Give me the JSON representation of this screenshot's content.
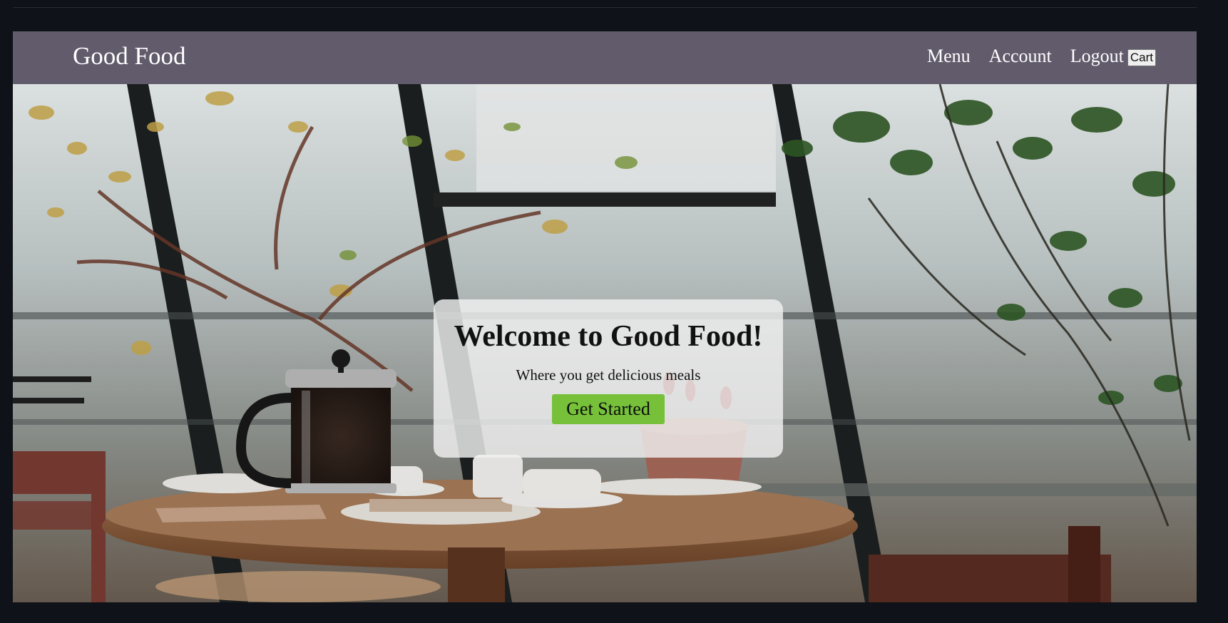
{
  "navbar": {
    "brand": "Good Food",
    "links": [
      "Menu",
      "Account",
      "Logout"
    ],
    "cart_label": "Cart",
    "background_color": "#625b6c"
  },
  "hero": {
    "background_image": "cafe-table-with-french-press-and-plants",
    "title": "Welcome to Good Food!",
    "subtitle": "Where you get delicious meals",
    "cta_label": "Get Started",
    "cta_color": "#76c03a"
  },
  "page_background": "#0f1319"
}
